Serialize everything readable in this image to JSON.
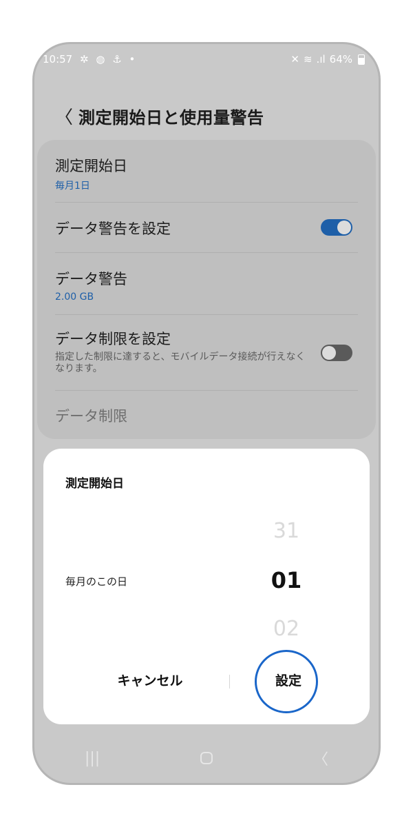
{
  "status_bar": {
    "time": "10:57",
    "left_icons": [
      "✲",
      "◍",
      "⚓",
      "•"
    ],
    "right_icons": [
      "✕",
      "≋"
    ],
    "signal": ".ıl",
    "battery": "64%"
  },
  "header": {
    "back_glyph": "〈",
    "title": "測定開始日と使用量警告"
  },
  "settings": {
    "start_date": {
      "label": "測定開始日",
      "value": "毎月1日"
    },
    "data_warning_toggle": {
      "label": "データ警告を設定",
      "state": "on"
    },
    "data_warning": {
      "label": "データ警告",
      "value": "2.00 GB"
    },
    "data_limit_toggle": {
      "label": "データ制限を設定",
      "description": "指定した制限に達すると、モバイルデータ接続が行えなくなります。",
      "state": "off"
    },
    "data_limit": {
      "label": "データ制限"
    }
  },
  "dialog": {
    "title": "測定開始日",
    "label": "毎月のこの日",
    "picker": {
      "prev": "31",
      "selected": "01",
      "next": "02"
    },
    "cancel_label": "キャンセル",
    "set_label": "設定"
  },
  "colors": {
    "accent": "#1e5fa8",
    "highlight_ring": "#1a66c9",
    "dim_background": "#c9c9c9"
  },
  "nav": {
    "recents": "|||",
    "back": "〈"
  }
}
